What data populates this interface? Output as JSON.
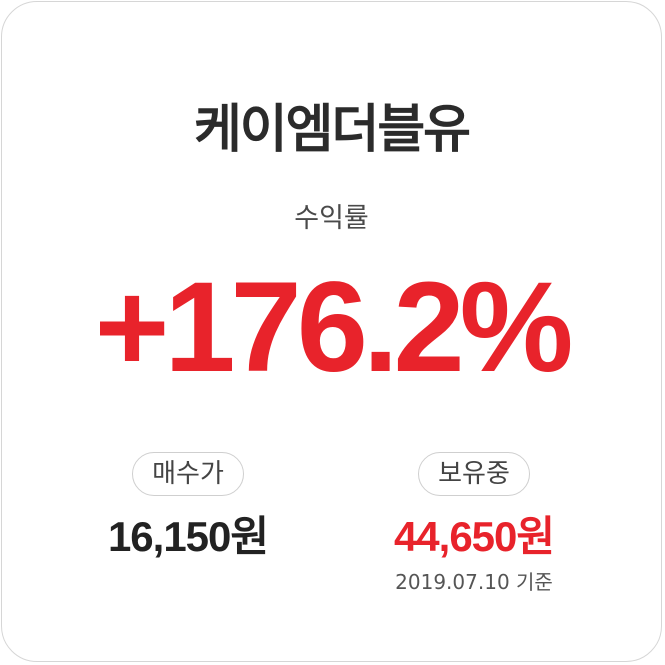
{
  "company_name": "케이엠더블유",
  "return": {
    "label": "수익률",
    "value": "+176.2%"
  },
  "buy": {
    "label": "매수가",
    "price": "16,150원"
  },
  "hold": {
    "label": "보유중",
    "price": "44,650원",
    "as_of": "2019.07.10 기준"
  },
  "colors": {
    "accent_red": "#e8232b",
    "text_dark": "#222222",
    "border": "#d6d6d6"
  }
}
